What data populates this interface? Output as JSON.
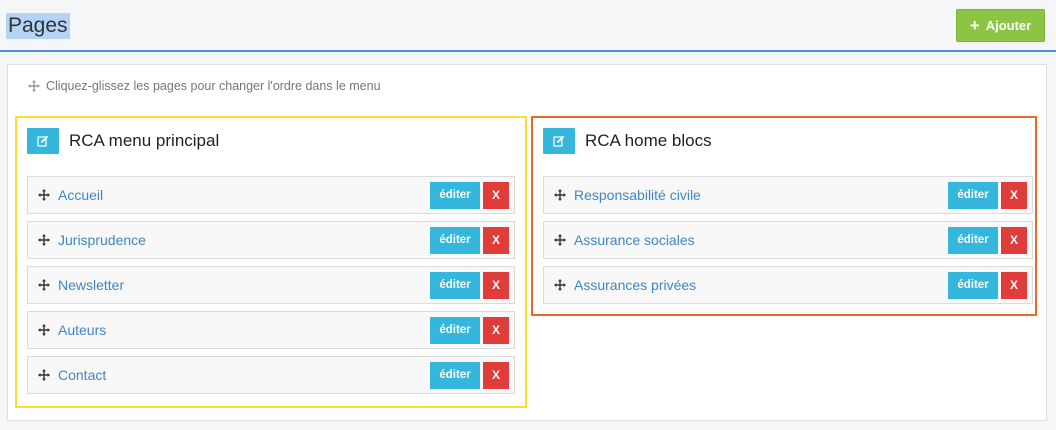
{
  "header": {
    "title": "Pages",
    "add_label": "Ajouter"
  },
  "hint": "Cliquez-glissez les pages pour changer l'ordre dans le menu",
  "menus": [
    {
      "title": "RCA menu principal",
      "items": [
        {
          "label": "Accueil",
          "edit": "éditer",
          "delete": "X"
        },
        {
          "label": "Jurisprudence",
          "edit": "éditer",
          "delete": "X"
        },
        {
          "label": "Newsletter",
          "edit": "éditer",
          "delete": "X"
        },
        {
          "label": "Auteurs",
          "edit": "éditer",
          "delete": "X"
        },
        {
          "label": "Contact",
          "edit": "éditer",
          "delete": "X"
        }
      ]
    },
    {
      "title": "RCA home blocs",
      "items": [
        {
          "label": "Responsabilité civile",
          "edit": "éditer",
          "delete": "X"
        },
        {
          "label": "Assurance sociales",
          "edit": "éditer",
          "delete": "X"
        },
        {
          "label": "Assurances privées",
          "edit": "éditer",
          "delete": "X"
        }
      ]
    }
  ],
  "colors": {
    "accent_blue": "#35b6dc",
    "add_green": "#8cc443",
    "delete_red": "#e03c3a",
    "left_menu_border": "#f5df2f",
    "right_menu_border": "#ea6a24",
    "link_blue": "#3f86c6"
  }
}
